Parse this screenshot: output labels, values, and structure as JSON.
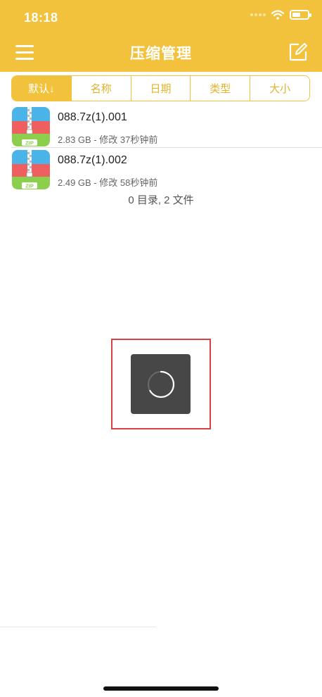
{
  "status_bar": {
    "time": "18:18",
    "battery_level": 0.55
  },
  "header": {
    "title": "压缩管理"
  },
  "sort_tabs": [
    {
      "label": "默认↓",
      "selected": true
    },
    {
      "label": "名称",
      "selected": false
    },
    {
      "label": "日期",
      "selected": false
    },
    {
      "label": "类型",
      "selected": false
    },
    {
      "label": "大小",
      "selected": false
    }
  ],
  "files": [
    {
      "name": "088.7z(1).001",
      "meta": "2.83 GB - 修改 37秒钟前",
      "icon_label": "ZIP"
    },
    {
      "name": "088.7z(1).002",
      "meta": "2.49 GB - 修改 58秒钟前",
      "icon_label": "ZIP"
    }
  ],
  "summary": "0 目录, 2 文件",
  "colors": {
    "accent": "#f2c23c",
    "highlight": "#d84043"
  }
}
